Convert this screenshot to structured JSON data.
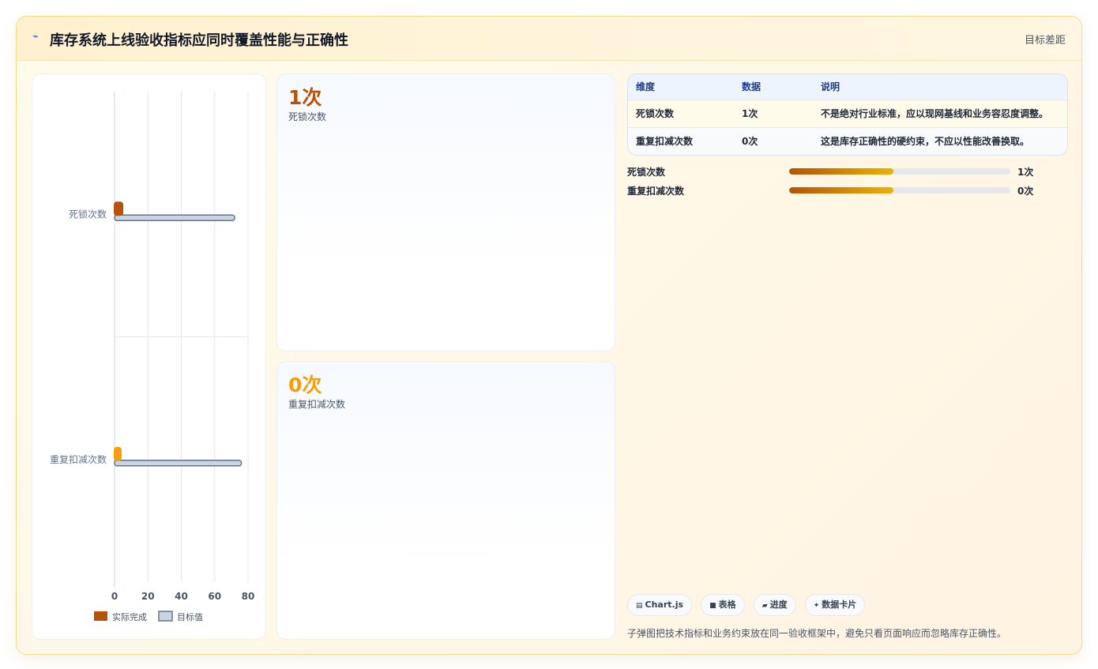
{
  "header": {
    "icon": "pulse-icon",
    "icon_glyph": "⌁",
    "title": "库存系统上线验收指标应同时覆盖性能与正确性",
    "right_label": "目标差距"
  },
  "chart_data": {
    "type": "bar",
    "orientation": "horizontal",
    "categories": [
      "死锁次数",
      "重复扣减次数"
    ],
    "series": [
      {
        "name": "实际完成",
        "values": [
          1,
          0
        ],
        "colors": [
          "#b45309",
          "#f59e0b"
        ]
      },
      {
        "name": "目标值",
        "values": [
          72,
          76
        ],
        "color": "#cbd5e1"
      }
    ],
    "xlim": [
      0,
      80
    ],
    "xticks": [
      0,
      20,
      40,
      60,
      80
    ],
    "grid": true,
    "legend": "bottom",
    "title": "",
    "xlabel": "",
    "ylabel": ""
  },
  "kpis": [
    {
      "value": "1次",
      "label": "死锁次数",
      "color": "#b45309"
    },
    {
      "value": "0次",
      "label": "重复扣减次数",
      "color": "#f59e0b"
    }
  ],
  "table": {
    "headers": [
      "维度",
      "数据",
      "说明"
    ],
    "rows": [
      [
        "死锁次数",
        "1次",
        "不是绝对行业标准，应以现网基线和业务容忍度调整。"
      ],
      [
        "重复扣减次数",
        "0次",
        "这是库存正确性的硬约束，不应以性能改善换取。"
      ]
    ]
  },
  "progress": [
    {
      "label": "死锁次数",
      "value_text": "1次",
      "fill": 0.47
    },
    {
      "label": "重复扣减次数",
      "value_text": "0次",
      "fill": 0.47
    }
  ],
  "chips": [
    {
      "icon": "chart-icon",
      "glyph": "▤",
      "label": "Chart.js"
    },
    {
      "icon": "table-icon",
      "glyph": "■",
      "label": "表格"
    },
    {
      "icon": "progress-icon",
      "glyph": "▰",
      "label": "进度"
    },
    {
      "icon": "sparkle-icon",
      "glyph": "✦",
      "label": "数据卡片"
    }
  ],
  "footnote": "子弹图把技术指标和业务约束放在同一验收框架中，避免只看页面响应而忽略库存正确性。"
}
